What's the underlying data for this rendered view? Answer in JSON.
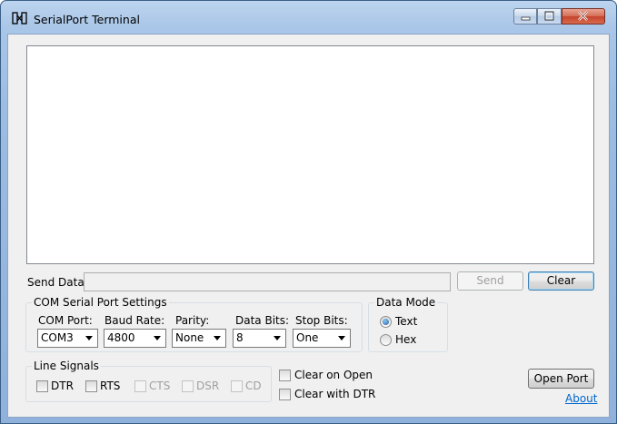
{
  "window": {
    "title": "SerialPort Terminal"
  },
  "send": {
    "label": "Send Data:",
    "value": "",
    "send_button": "Send",
    "clear_button": "Clear"
  },
  "settings": {
    "group_title": "COM Serial Port Settings",
    "com_port": {
      "label": "COM Port:",
      "value": "COM3"
    },
    "baud_rate": {
      "label": "Baud Rate:",
      "value": "4800"
    },
    "parity": {
      "label": "Parity:",
      "value": "None"
    },
    "data_bits": {
      "label": "Data Bits:",
      "value": "8"
    },
    "stop_bits": {
      "label": "Stop Bits:",
      "value": "One"
    }
  },
  "data_mode": {
    "group_title": "Data Mode",
    "text_label": "Text",
    "hex_label": "Hex",
    "selected": "Text"
  },
  "line_signals": {
    "group_title": "Line Signals",
    "dtr": "DTR",
    "rts": "RTS",
    "cts": "CTS",
    "dsr": "DSR",
    "cd": "CD"
  },
  "options": {
    "clear_on_open": "Clear on Open",
    "clear_with_dtr": "Clear with DTR"
  },
  "actions": {
    "open_port": "Open Port",
    "about": "About"
  }
}
